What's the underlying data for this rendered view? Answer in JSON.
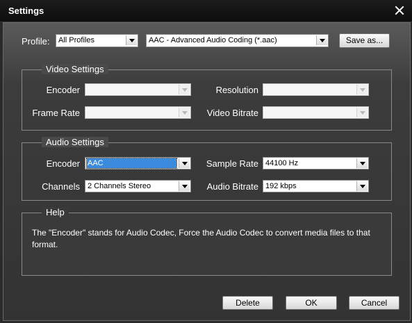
{
  "window": {
    "title": "Settings"
  },
  "profile": {
    "label": "Profile:",
    "category": "All Profiles",
    "format": "AAC - Advanced Audio Coding (*.aac)",
    "save_as_label": "Save as..."
  },
  "video": {
    "title": "Video Settings",
    "encoder_label": "Encoder",
    "resolution_label": "Resolution",
    "frame_rate_label": "Frame Rate",
    "video_bitrate_label": "Video Bitrate",
    "encoder": "",
    "resolution": "",
    "frame_rate": "",
    "video_bitrate": ""
  },
  "audio": {
    "title": "Audio Settings",
    "encoder_label": "Encoder",
    "sample_rate_label": "Sample Rate",
    "channels_label": "Channels",
    "audio_bitrate_label": "Audio Bitrate",
    "encoder": "AAC",
    "sample_rate": "44100 Hz",
    "channels": "2 Channels Stereo",
    "audio_bitrate": "192 kbps"
  },
  "help": {
    "title": "Help",
    "text": "The \"Encoder\" stands for Audio Codec, Force the Audio Codec to convert media files to that format."
  },
  "buttons": {
    "delete": "Delete",
    "ok": "OK",
    "cancel": "Cancel"
  }
}
